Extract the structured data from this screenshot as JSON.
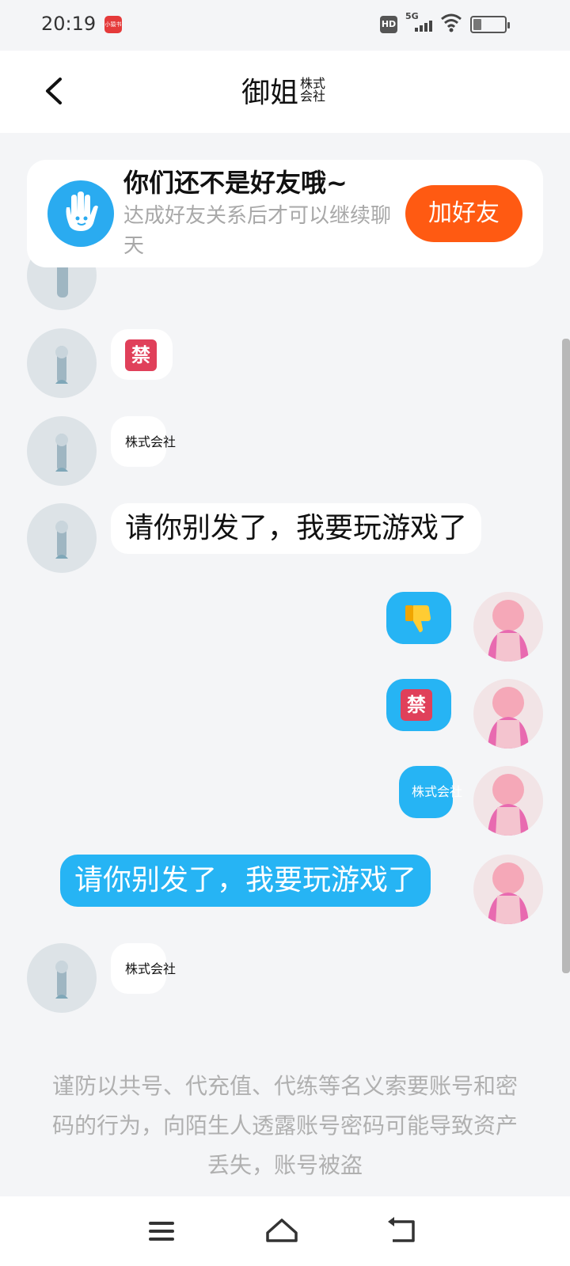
{
  "status_bar": {
    "time": "20:19",
    "app_badge": "小猿书",
    "hd_label": "HD",
    "network_label": "5G"
  },
  "header": {
    "title": "御姐",
    "badge": "株式会社"
  },
  "notice": {
    "title": "你们还不是好友哦~",
    "subtitle": "达成好友关系后才可以继续聊天",
    "button": "加好友"
  },
  "messages": {
    "m1": "🈲",
    "m2": "株式会社",
    "m3": "请你别发了，我要玩游戏了",
    "m4_icon": "thumbs-down",
    "m5": "🈲",
    "m6": "株式会社",
    "m7": "请你别发了，我要玩游戏了",
    "m8": "株式会社"
  },
  "ban_glyph": "禁",
  "warning": "谨防以共号、代充值、代练等名义索要账号和密码的行为，向陌生人透露账号密码可能导致资产丢失，账号被盗",
  "colors": {
    "accent_blue": "#26b4f4",
    "add_friend_orange": "#ff5a12",
    "background": "#f4f5f7"
  }
}
